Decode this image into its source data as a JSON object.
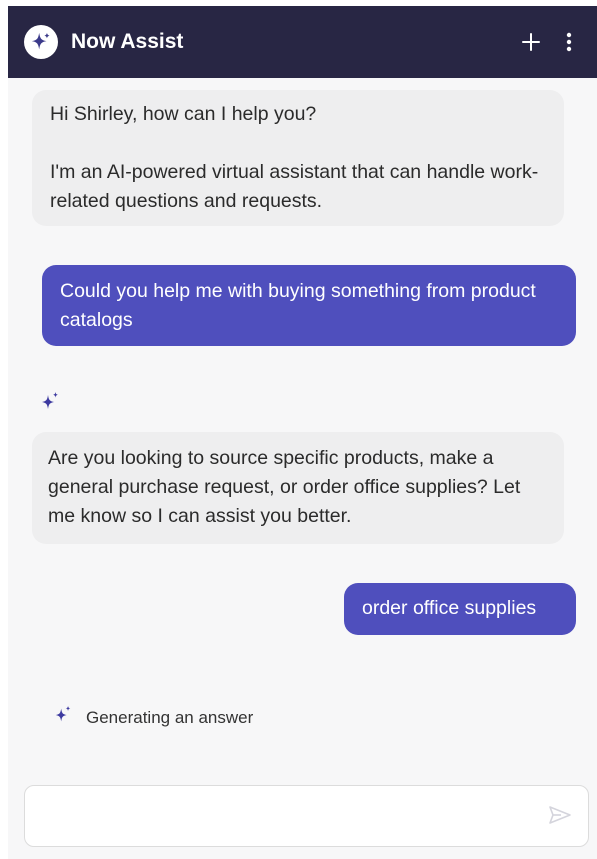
{
  "header": {
    "title": "Now Assist",
    "logo_icon": "sparkle-icon",
    "new_chat_icon": "plus-icon",
    "menu_icon": "kebab-menu-icon",
    "background": "#282644"
  },
  "messages": [
    {
      "role": "assistant",
      "lines": [
        "Hi Shirley, how can I help you?",
        "I'm an AI-powered virtual assistant that can handle work-related questions and requests."
      ]
    },
    {
      "role": "user",
      "text": "Could you help me with buying something from product catalogs"
    },
    {
      "role": "assistant",
      "icon": "sparkle-icon",
      "text": "Are you looking to source specific products, make a general purchase request, or order office supplies? Let me know so I can assist you better."
    },
    {
      "role": "user",
      "text": "order office supplies"
    }
  ],
  "status": {
    "icon": "sparkle-icon",
    "text": "Generating an answer"
  },
  "composer": {
    "value": "",
    "placeholder": "",
    "send_icon": "send-icon"
  },
  "colors": {
    "accent": "#4f4fbd",
    "bot_bubble": "#eeeeef",
    "chat_background": "#f7f7f8"
  }
}
